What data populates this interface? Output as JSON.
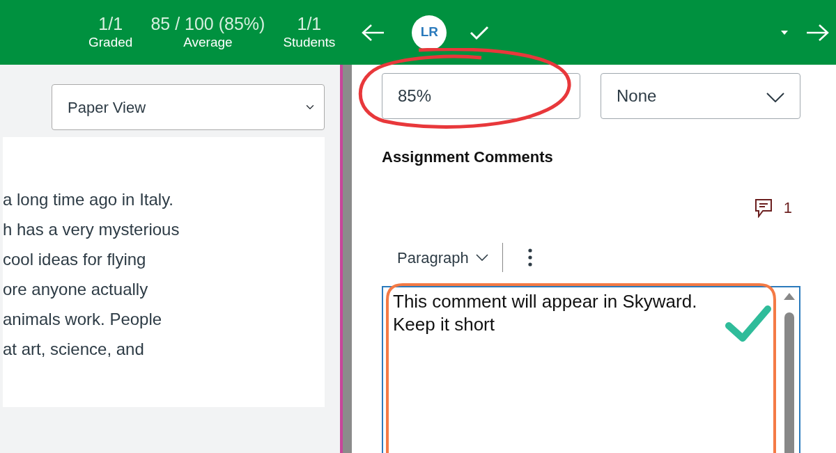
{
  "header": {
    "stats": [
      {
        "value": "1/1",
        "label": "Graded"
      },
      {
        "value": "85 / 100 (85%)",
        "label": "Average"
      },
      {
        "value": "1/1",
        "label": "Students"
      }
    ],
    "avatar_initials": "LR"
  },
  "left_panel": {
    "view_select": "Paper View",
    "document_lines": [
      "a long time ago in Italy.",
      "h has a very mysterious",
      "cool ideas for flying",
      "ore anyone actually",
      "animals work. People",
      "at art, science, and"
    ]
  },
  "right_panel": {
    "grade_field": {
      "value": "85%"
    },
    "status_select": "None",
    "comments_heading": "Assignment Comments",
    "comment_count": "1",
    "block_format": "Paragraph",
    "comment_box": {
      "value": "This comment will appear in Skyward.\nKeep it short"
    }
  }
}
